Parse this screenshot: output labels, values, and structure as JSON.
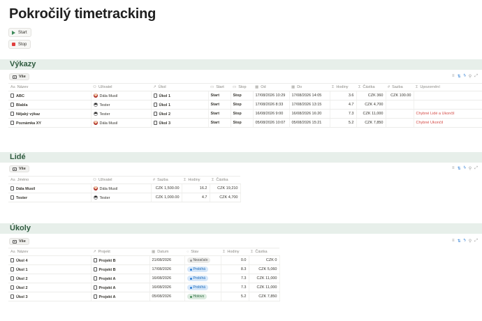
{
  "page": {
    "title": "Pokročilý timetracking"
  },
  "actions": {
    "start_label": "Start",
    "stop_label": "Stop"
  },
  "sections": {
    "vykazy": {
      "title": "Výkazy",
      "view": "Vše",
      "columns": [
        "Název",
        "Uživatel",
        "Úkol",
        "Start",
        "Stop",
        "Od",
        "Do",
        "Hodiny",
        "Částka",
        "Sazba",
        "Upozornění"
      ],
      "rows": [
        {
          "name": "ABC",
          "user": "Dála Musil",
          "task": "Úkol 1",
          "start": "Start",
          "stop": "Stop",
          "from": "17/08/2026 10:29",
          "to": "17/08/2026 14:05",
          "hours": "3.6",
          "amount": "CZK 360",
          "rate": "CZK 100.00",
          "warn": ""
        },
        {
          "name": "Blabla",
          "user": "Tester",
          "task": "Úkol 1",
          "start": "Start",
          "stop": "Stop",
          "from": "17/08/2026 8:33",
          "to": "17/08/2026 13:15",
          "hours": "4.7",
          "amount": "CZK 4,700",
          "rate": "",
          "warn": ""
        },
        {
          "name": "Nějaký výkaz",
          "user": "Tester",
          "task": "Úkol 2",
          "start": "Start",
          "stop": "Stop",
          "from": "16/08/2026 9:00",
          "to": "16/08/2026 16:20",
          "hours": "7.3",
          "amount": "CZK 11,000",
          "rate": "",
          "warn": "Chybné Lidé a Ukončil"
        },
        {
          "name": "Poznámka XY",
          "user": "Dála Musil",
          "task": "Úkol 3",
          "start": "Start",
          "stop": "Stop",
          "from": "05/08/2026 10:07",
          "to": "05/08/2026 15:21",
          "hours": "5.2",
          "amount": "CZK 7,850",
          "rate": "",
          "warn": "Chybné Ukončil"
        }
      ]
    },
    "lide": {
      "title": "Lidé",
      "view": "Vše",
      "columns": [
        "Jméno",
        "Uživatel",
        "Sazba",
        "Hodiny",
        "Částka"
      ],
      "rows": [
        {
          "name": "Dála Musil",
          "user": "Dála Musil",
          "rate": "CZK 1,500.00",
          "hours": "16.2",
          "amount": "CZK 19,210"
        },
        {
          "name": "Tester",
          "user": "Tester",
          "rate": "CZK 1,000.00",
          "hours": "4.7",
          "amount": "CZK 4,700"
        }
      ]
    },
    "ukoly": {
      "title": "Úkoly",
      "view": "Vše",
      "columns": [
        "Název",
        "Projekt",
        "Datum",
        "Stav",
        "Hodiny",
        "Částka"
      ],
      "rows": [
        {
          "name": "Úkol 4",
          "project": "Projekt B",
          "date": "21/08/2026",
          "status": "Nezačalo",
          "status_color": "gray",
          "hours": "0.0",
          "amount": "CZK 0"
        },
        {
          "name": "Úkol 1",
          "project": "Projekt B",
          "date": "17/08/2026",
          "status": "Probíhá",
          "status_color": "blue",
          "hours": "8.3",
          "amount": "CZK 5,060"
        },
        {
          "name": "Úkol 2",
          "project": "Projekt A",
          "date": "16/08/2026",
          "status": "Probíhá",
          "status_color": "blue",
          "hours": "7.3",
          "amount": "CZK 11,000"
        },
        {
          "name": "Úkol 2",
          "project": "Projekt A",
          "date": "16/08/2026",
          "status": "Probíhá",
          "status_color": "blue",
          "hours": "7.3",
          "amount": "CZK 11,000"
        },
        {
          "name": "Úkol 3",
          "project": "Projekt A",
          "date": "05/08/2026",
          "status": "Hotovo",
          "status_color": "green",
          "hours": "5.2",
          "amount": "CZK 7,850"
        }
      ]
    }
  },
  "colors": {
    "section_bg": "#e7efea",
    "section_text": "#2f5b3f",
    "warning": "#d44c47",
    "accent_blue": "#2f7fd6"
  }
}
